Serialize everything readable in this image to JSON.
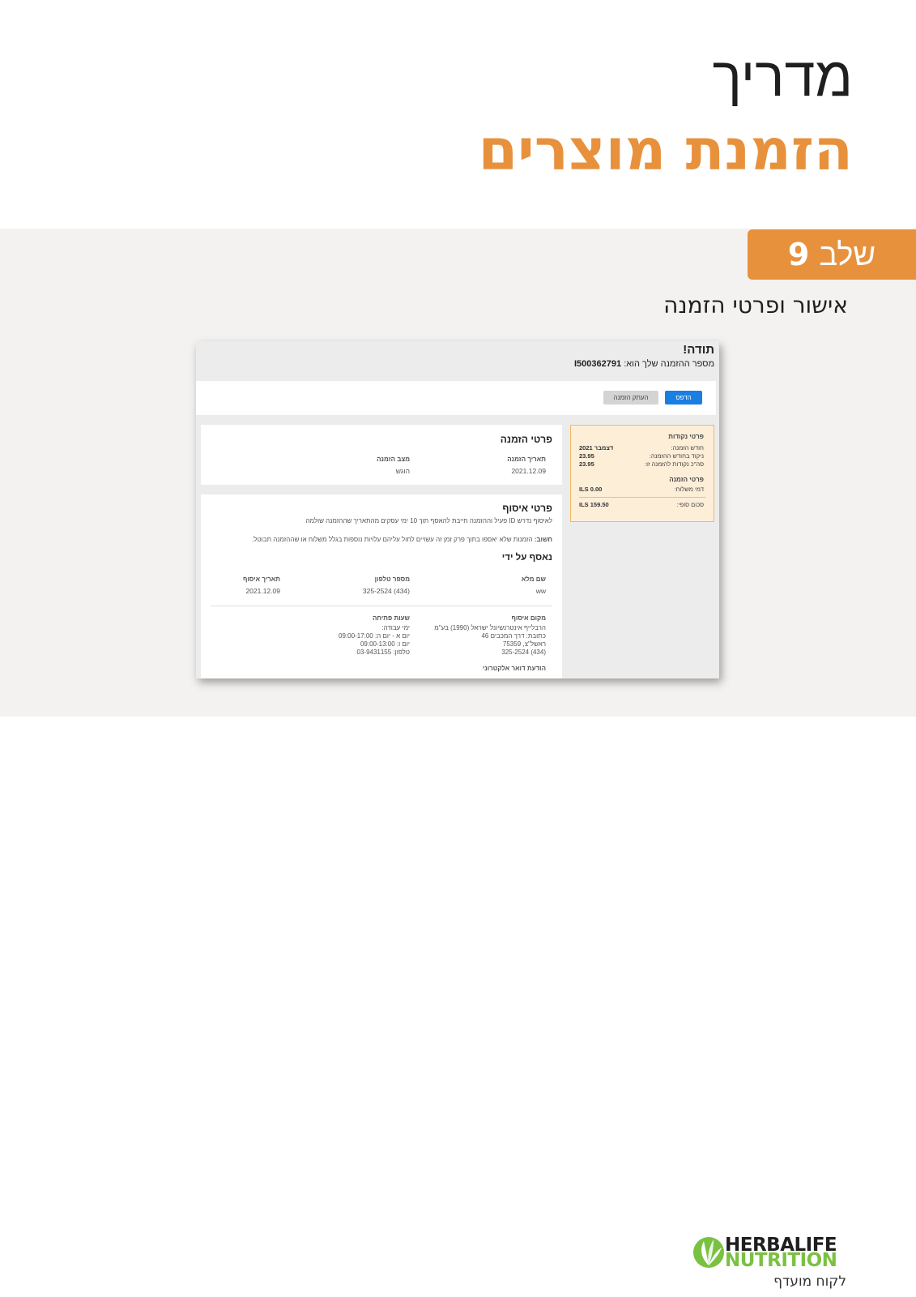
{
  "header": {
    "title_line1": "מדריך",
    "title_line2": "הזמנת מוצרים"
  },
  "step": {
    "label": "שלב",
    "number": "9"
  },
  "subtitle": "אישור ופרטי הזמנה",
  "screenshot": {
    "thanks": "תודה!",
    "order_number_label": "מספר ההזמנה שלך הוא:",
    "order_number": "I500362791",
    "buttons": {
      "print": "הדפס",
      "copy_order": "העתק הזמנה"
    },
    "order_details": {
      "title": "פרטי הזמנה",
      "date_label": "תאריך הזמנה",
      "date_value": "2021.12.09",
      "status_label": "מצב הזמנה",
      "status_value": "הוגש"
    },
    "pickup_details": {
      "title": "פרטי איסוף",
      "note1": "לאיסוף נדרש ID פעיל וההזמנה חייבת להאסף תוך 10 ימי עסקים מהתאריך שההזמנה שולמה",
      "note2_bold": "חשוב:",
      "note2": "הזמנות שלא יאספו בתוך פרק זמן זה עשויים לחול עליהם עלויות נוספות בגלל משלוח או שההזמנה תבוטל.",
      "collected_by_title": "נאסף על ידי",
      "full_name_label": "שם מלא",
      "full_name_value": "ww",
      "phone_label": "מספר טלפון",
      "phone_value": "325-2524 (434)",
      "pickup_date_label": "תאריך איסוף",
      "pickup_date_value": "2021.12.09",
      "location_label": "מקום איסוף",
      "location_line1": "הרבלייף אינטרנשיונל ישראל (1990) בע\"מ",
      "location_line2": "כתובת: דרך המכבים 46",
      "location_line3": "ראשל\"צ, 75359",
      "location_line4": "325-2524 (434)",
      "hours_label": "שעות פתיחה",
      "hours_line1": "ימי עבודה:",
      "hours_line2": "יום א - יום ה: 09:00-17:00",
      "hours_line3": "יום ו: 09:00-13:00",
      "hours_line4": "טלפון: 03-9431155",
      "email_notice": "הודעת דואר אלקטרוני"
    },
    "points": {
      "title": "פרטי נקודות",
      "month_label": "חודש הזמנה:",
      "month_value": "דצמבר 2021",
      "month_points_label": "ניקוד בחודש ההזמנה:",
      "month_points_value": "23.95",
      "order_points_label": "סה\"כ נקודות להזמנה זו:",
      "order_points_value": "23.95",
      "order_details_title": "פרטי הזמנה",
      "shipping_label": "דמי משלוח:",
      "shipping_value": "ILS 0.00",
      "total_label": "סכום סופי:",
      "total_value": "ILS 159.50"
    }
  },
  "logo": {
    "line1": "HERBALIFE",
    "line2": "NUTRITION",
    "tagline": "לקוח מועדף"
  }
}
